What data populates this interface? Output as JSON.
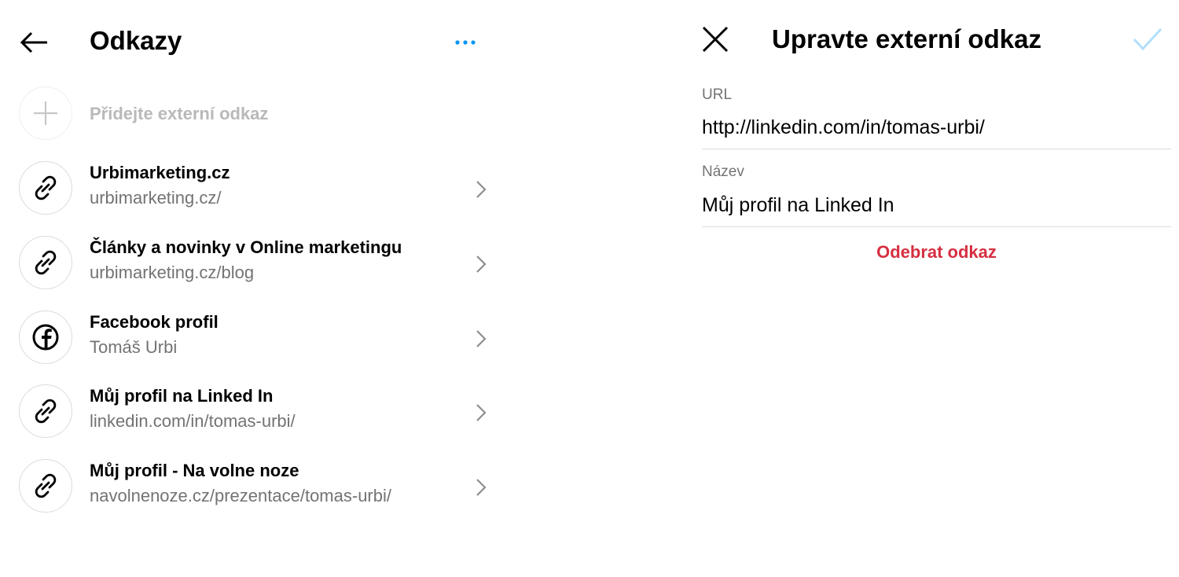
{
  "left": {
    "title": "Odkazy",
    "add_label": "Přidejte externí odkaz",
    "links": [
      {
        "title": "Urbimarketing.cz",
        "subtitle": "urbimarketing.cz/",
        "icon": "link-icon"
      },
      {
        "title": "Články a novinky v Online marketingu",
        "subtitle": "urbimarketing.cz/blog",
        "icon": "link-icon"
      },
      {
        "title": "Facebook profil",
        "subtitle": "Tomáš Urbi",
        "icon": "facebook-icon"
      },
      {
        "title": "Můj profil na Linked In",
        "subtitle": "linkedin.com/in/tomas-urbi/",
        "icon": "link-icon"
      },
      {
        "title": "Můj profil - Na volne noze",
        "subtitle": "navolnenoze.cz/prezentace/tomas-urbi/",
        "icon": "link-icon"
      }
    ]
  },
  "right": {
    "title": "Upravte externí odkaz",
    "url_label": "URL",
    "url_value": "http://linkedin.com/in/tomas-urbi/",
    "name_label": "Název",
    "name_value": "Můj profil na Linked In",
    "remove_label": "Odebrat odkaz"
  },
  "colors": {
    "accent_blue": "#0095f6",
    "check_disabled": "#b2dffc",
    "danger": "#d62f41",
    "secondary_text": "#737373",
    "divider": "#dbdbdb"
  }
}
